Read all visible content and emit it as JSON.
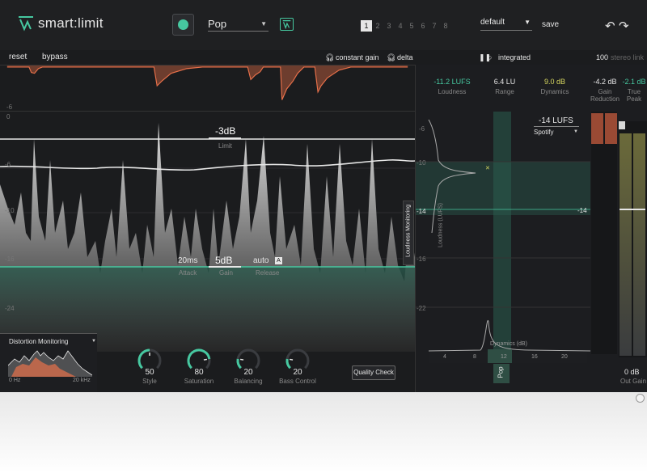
{
  "header": {
    "app_name": "smart:limit",
    "preset": "Pop",
    "slots": [
      "1",
      "2",
      "3",
      "4",
      "5",
      "6",
      "7",
      "8"
    ],
    "active_slot": "1",
    "settings_preset": "default",
    "save_label": "save"
  },
  "toolbar": {
    "reset": "reset",
    "bypass": "bypass",
    "constant_gain": "constant gain",
    "delta": "delta",
    "integrated": "integrated",
    "stereo_value": "100",
    "stereo_link": "stereo link"
  },
  "stats": {
    "loudness_value": "-11.2 LUFS",
    "loudness_label": "Loudness",
    "range_value": "6.4 LU",
    "range_label": "Range",
    "dynamics_value": "9.0 dB",
    "dynamics_label": "Dynamics",
    "gr_value": "-4.2 dB",
    "gr_label": "Gain Reduction",
    "tp_value": "-2.1 dB",
    "tp_label": "True Peak"
  },
  "plot": {
    "gr_axis_label": "-6",
    "y_labels": [
      "0",
      "-6",
      "-10",
      "-16",
      "-24"
    ],
    "limit_value": "-3dB",
    "limit_label": "Limit",
    "attack_value": "20ms",
    "attack_label": "Attack",
    "gain_value": "5dB",
    "gain_label": "Gain",
    "release_value": "auto",
    "release_label": "Release",
    "release_badge": "A",
    "loudness_monitoring": "Loudness Monitoring"
  },
  "distortion": {
    "title": "Distortion Monitoring",
    "x_min": "0 Hz",
    "x_max": "20 kHz"
  },
  "knobs": [
    {
      "value": "50",
      "label": "Style",
      "level": 0.5
    },
    {
      "value": "80",
      "label": "Saturation",
      "level": 0.8
    },
    {
      "value": "20",
      "label": "Balancing",
      "level": 0.2
    },
    {
      "value": "20",
      "label": "Bass Control",
      "level": 0.2
    }
  ],
  "quality_check": "Quality Check",
  "loudness_panel": {
    "target": "-14 LUFS",
    "platform": "Spotify",
    "y_labels": [
      "-6",
      "-10",
      "-14",
      "-16",
      "-22"
    ],
    "right_marker": "-14",
    "y_axis": "Loudness (LUFS)",
    "x_axis": "Dynamics (dB)",
    "x_labels": [
      "4",
      "8",
      "12",
      "16",
      "20"
    ],
    "genre": "Pop",
    "out_gain_value": "0 dB",
    "out_gain_label": "Out Gain"
  },
  "colors": {
    "accent": "#46c8a0",
    "gr_orange": "#e8704a",
    "background": "#1b1c1e"
  }
}
